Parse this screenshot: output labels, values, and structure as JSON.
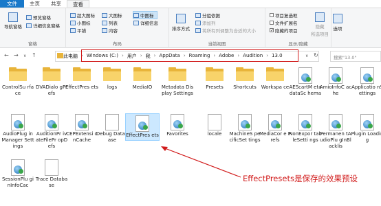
{
  "tabs": [
    {
      "label": "文件",
      "kind": "file"
    },
    {
      "label": "主页",
      "kind": "normal"
    },
    {
      "label": "共享",
      "kind": "normal"
    },
    {
      "label": "查看",
      "kind": "active"
    }
  ],
  "ribbon": {
    "panes": {
      "nav_pane": "导航窗格",
      "preview_pane": "预览窗格",
      "details_pane": "详细信息窗格",
      "title": "窗格"
    },
    "layout": {
      "items": [
        "超大图标",
        "大图标",
        "中图标",
        "小图标",
        "列表",
        "详细信息",
        "平铺",
        "内容"
      ],
      "title": "布局"
    },
    "current_view": {
      "sort": "排序方式",
      "group_by": "分组依据",
      "add_columns": "添加列",
      "size_all_columns": "将所有列调整为合适的大小",
      "title": "当前视图"
    },
    "show_hide": {
      "item_checkboxes": "项目复选框",
      "file_extensions": "文件扩展名",
      "hidden_items": "隐藏的项目",
      "hide_selected": "隐藏",
      "hide_selected_2": "所选项目",
      "title": "显示/隐藏"
    },
    "options": "选项"
  },
  "nav": {
    "back": "←",
    "forward": "→",
    "recent": "∨",
    "up": "↑",
    "refresh": "↻",
    "dropdown": "∨",
    "breadcrumbs": [
      "此电脑",
      "Windows (C:)",
      "用户",
      "我",
      "AppData",
      "Roaming",
      "Adobe",
      "Audition",
      "13.0"
    ],
    "search_placeholder": "搜索\"13.0\""
  },
  "files": [
    {
      "name": "ControlSurface",
      "label": "ControlSu rface",
      "type": "folder"
    },
    {
      "name": "DVADialogPrefs",
      "label": "DVADialo gPrefs",
      "type": "folder"
    },
    {
      "name": "EffectPresets",
      "label": "EffectPres ets",
      "type": "folder"
    },
    {
      "name": "logs",
      "label": "logs",
      "type": "folder"
    },
    {
      "name": "MediaIO",
      "label": "MediaIO",
      "type": "folder"
    },
    {
      "name": "Metadata Display Settings",
      "label": "Metadata Display Settings",
      "type": "folder"
    },
    {
      "name": "Presets",
      "label": "Presets",
      "type": "folder"
    },
    {
      "name": "Shortcuts",
      "label": "Shortcuts",
      "type": "folder"
    },
    {
      "name": "Workspace",
      "label": "Workspa ce",
      "type": "folder"
    },
    {
      "name": "AEScartMetadataSchema",
      "label": "AEScartM etadataSc hema",
      "type": "doc"
    },
    {
      "name": "AmioInfoCache",
      "label": "AmioInfoC ache",
      "type": "doc"
    },
    {
      "name": "ApplicationSettings",
      "label": "Applicatio nSettings",
      "type": "doc"
    },
    {
      "name": "AudioPluginManagerSettings",
      "label": "AudioPlug inManager Settings",
      "type": "doc"
    },
    {
      "name": "AuditionPrivateFilePropDefs",
      "label": "AuditionPr ivateFilePr opDefs",
      "type": "doc"
    },
    {
      "name": "CEPExtensionCache",
      "label": "CEPExtensi onCache",
      "type": "doc"
    },
    {
      "name": "Debug Database",
      "label": "Debug Database",
      "type": "blank"
    },
    {
      "name": "EffectPresets",
      "label": "EffectPres ets",
      "type": "doc",
      "selected": true
    },
    {
      "name": "Favorites",
      "label": "Favorites",
      "type": "doc"
    },
    {
      "name": "locale",
      "label": "locale",
      "type": "blank"
    },
    {
      "name": "MachineSpecificSettings",
      "label": "MachineS pecificSet tings",
      "type": "doc"
    },
    {
      "name": "MediaCorePrefs",
      "label": "MediaCor e Prefs",
      "type": "doc"
    },
    {
      "name": "NonExportableSettings",
      "label": "NonExpor tableSetti ngs",
      "type": "doc"
    },
    {
      "name": "PermanentAudioPluginBlacklist",
      "label": "Permanen tAudioPlu gInBlacklis",
      "type": "doc"
    },
    {
      "name": "PluginLoading",
      "label": "Plugin Loading",
      "type": "doc"
    },
    {
      "name": "SessionPluginInfoCache",
      "label": "SessionPlu ginInfoCac",
      "type": "doc"
    },
    {
      "name": "Trace Database",
      "label": "Trace Database",
      "type": "blank"
    }
  ],
  "annotation": "EffectPresets是保存的效果预设",
  "colors": {
    "annotation": "#d11a1a",
    "file_tab": "#1979ca",
    "folder": "#e8b43a",
    "selected": "#cce8ff"
  }
}
